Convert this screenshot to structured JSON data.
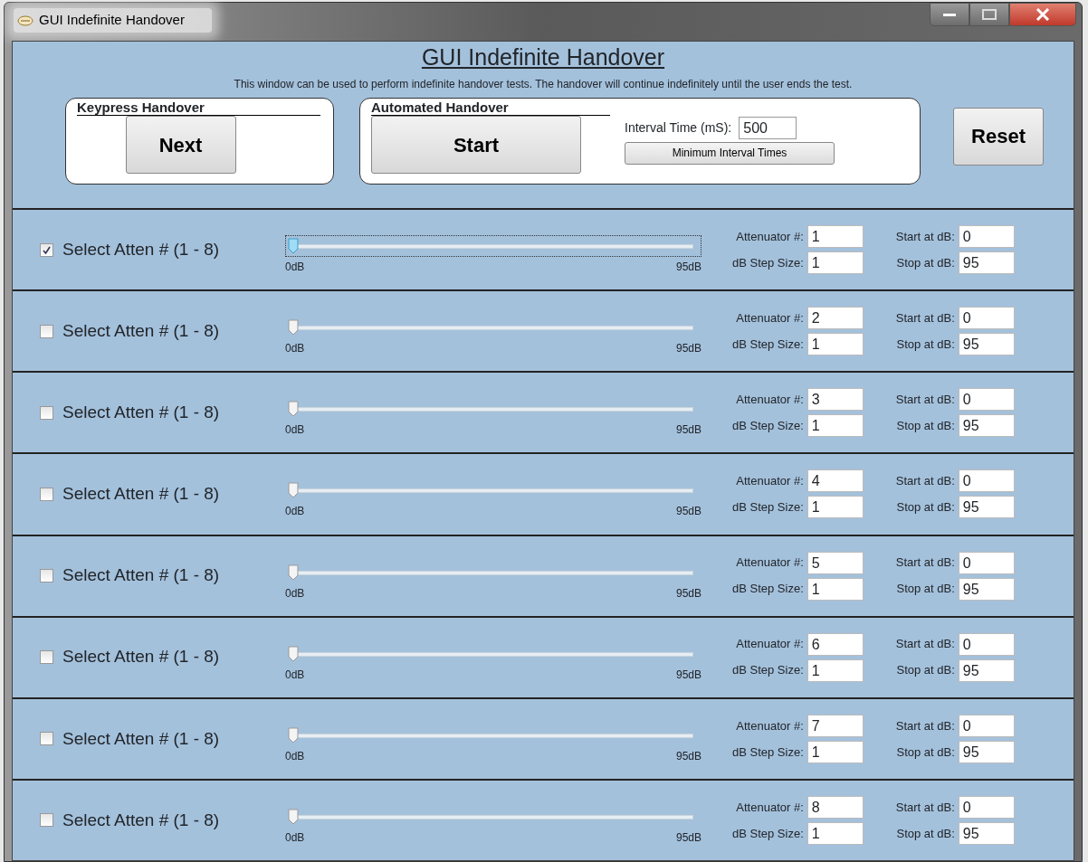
{
  "window": {
    "title": "GUI Indefinite Handover"
  },
  "heading": "GUI Indefinite Handover",
  "description": "This window can be used to perform indefinite handover tests.  The handover will continue indefinitely until the user ends the test.",
  "keypress": {
    "title": "Keypress Handover",
    "button": "Next"
  },
  "automated": {
    "title": "Automated Handover",
    "button": "Start",
    "interval_label": "Interval Time (mS):",
    "interval_value": "500",
    "min_button": "Minimum Interval Times"
  },
  "reset_button": "Reset",
  "rows": [
    {
      "label": "Select Atten # (1 - 8)",
      "checked": true,
      "focused": true,
      "level": 0,
      "min": "0dB",
      "max": "95dB",
      "attenuator_label": "Attenuator #:",
      "attenuator": "1",
      "step_label": "dB Step Size:",
      "step": "1",
      "start_label": "Start at dB:",
      "start": "0",
      "stop_label": "Stop at dB:",
      "stop": "95"
    },
    {
      "label": "Select Atten # (1 - 8)",
      "checked": false,
      "focused": false,
      "level": 0,
      "min": "0dB",
      "max": "95dB",
      "attenuator_label": "Attenuator #:",
      "attenuator": "2",
      "step_label": "dB Step Size:",
      "step": "1",
      "start_label": "Start at dB:",
      "start": "0",
      "stop_label": "Stop at dB:",
      "stop": "95"
    },
    {
      "label": "Select Atten # (1 - 8)",
      "checked": false,
      "focused": false,
      "level": 0,
      "min": "0dB",
      "max": "95dB",
      "attenuator_label": "Attenuator #:",
      "attenuator": "3",
      "step_label": "dB Step Size:",
      "step": "1",
      "start_label": "Start at dB:",
      "start": "0",
      "stop_label": "Stop at dB:",
      "stop": "95"
    },
    {
      "label": "Select Atten # (1 - 8)",
      "checked": false,
      "focused": false,
      "level": 0,
      "min": "0dB",
      "max": "95dB",
      "attenuator_label": "Attenuator #:",
      "attenuator": "4",
      "step_label": "dB Step Size:",
      "step": "1",
      "start_label": "Start at dB:",
      "start": "0",
      "stop_label": "Stop at dB:",
      "stop": "95"
    },
    {
      "label": "Select Atten # (1 - 8)",
      "checked": false,
      "focused": false,
      "level": 0,
      "min": "0dB",
      "max": "95dB",
      "attenuator_label": "Attenuator #:",
      "attenuator": "5",
      "step_label": "dB Step Size:",
      "step": "1",
      "start_label": "Start at dB:",
      "start": "0",
      "stop_label": "Stop at dB:",
      "stop": "95"
    },
    {
      "label": "Select Atten # (1 - 8)",
      "checked": false,
      "focused": false,
      "level": 0,
      "min": "0dB",
      "max": "95dB",
      "attenuator_label": "Attenuator #:",
      "attenuator": "6",
      "step_label": "dB Step Size:",
      "step": "1",
      "start_label": "Start at dB:",
      "start": "0",
      "stop_label": "Stop at dB:",
      "stop": "95"
    },
    {
      "label": "Select Atten # (1 - 8)",
      "checked": false,
      "focused": false,
      "level": 0,
      "min": "0dB",
      "max": "95dB",
      "attenuator_label": "Attenuator #:",
      "attenuator": "7",
      "step_label": "dB Step Size:",
      "step": "1",
      "start_label": "Start at dB:",
      "start": "0",
      "stop_label": "Stop at dB:",
      "stop": "95"
    },
    {
      "label": "Select Atten # (1 - 8)",
      "checked": false,
      "focused": false,
      "level": 0,
      "min": "0dB",
      "max": "95dB",
      "attenuator_label": "Attenuator #:",
      "attenuator": "8",
      "step_label": "dB Step Size:",
      "step": "1",
      "start_label": "Start at dB:",
      "start": "0",
      "stop_label": "Stop at dB:",
      "stop": "95"
    }
  ]
}
